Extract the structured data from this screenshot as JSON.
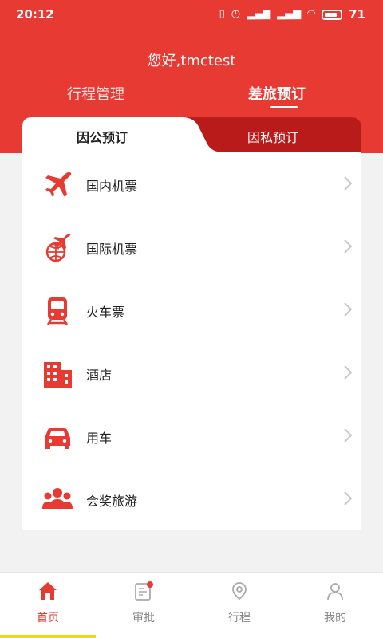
{
  "status_bar": {
    "time": "20:12",
    "battery": "71"
  },
  "header": {
    "greeting": "您好,tmctest"
  },
  "top_tabs": [
    {
      "label": "行程管理"
    },
    {
      "label": "差旅预订"
    }
  ],
  "sub_tabs": [
    {
      "label": "因公预订"
    },
    {
      "label": "因私预订"
    }
  ],
  "menu": [
    {
      "label": "国内机票",
      "icon": "airplane-icon"
    },
    {
      "label": "国际机票",
      "icon": "globe-airplane-icon"
    },
    {
      "label": "火车票",
      "icon": "train-icon"
    },
    {
      "label": "酒店",
      "icon": "hotel-icon"
    },
    {
      "label": "用车",
      "icon": "car-icon"
    },
    {
      "label": "会奖旅游",
      "icon": "group-icon"
    }
  ],
  "tab_bar": [
    {
      "label": "首页",
      "icon": "home-icon"
    },
    {
      "label": "审批",
      "icon": "approval-icon"
    },
    {
      "label": "行程",
      "icon": "location-icon"
    },
    {
      "label": "我的",
      "icon": "user-icon"
    }
  ],
  "colors": {
    "brand": "#e63a32",
    "brand_dark": "#b91b1b"
  }
}
